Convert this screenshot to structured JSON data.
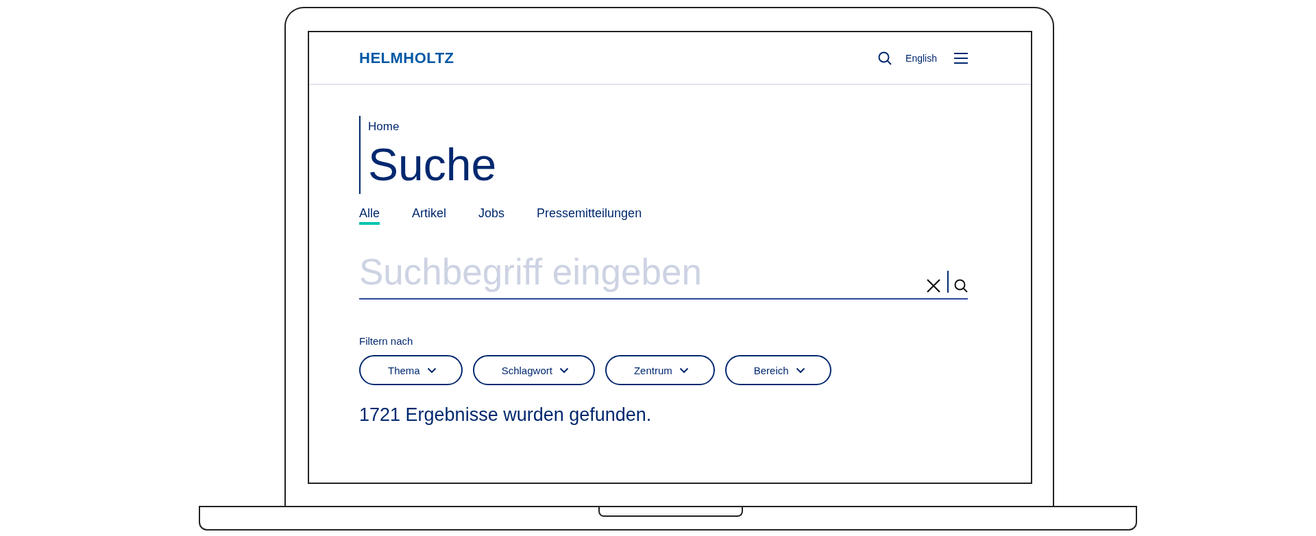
{
  "header": {
    "logo": "HELMHOLTZ",
    "language": "English"
  },
  "breadcrumb": "Home",
  "title": "Suche",
  "tabs": [
    {
      "label": "Alle",
      "selected": true
    },
    {
      "label": "Artikel",
      "selected": false
    },
    {
      "label": "Jobs",
      "selected": false
    },
    {
      "label": "Pressemitteilungen",
      "selected": false
    }
  ],
  "search": {
    "placeholder": "Suchbegriff eingeben"
  },
  "filter_label": "Filtern nach",
  "filters": [
    "Thema",
    "Schlagwort",
    "Zentrum",
    "Bereich"
  ],
  "result_text": "1721 Ergebnisse wurden gefunden."
}
